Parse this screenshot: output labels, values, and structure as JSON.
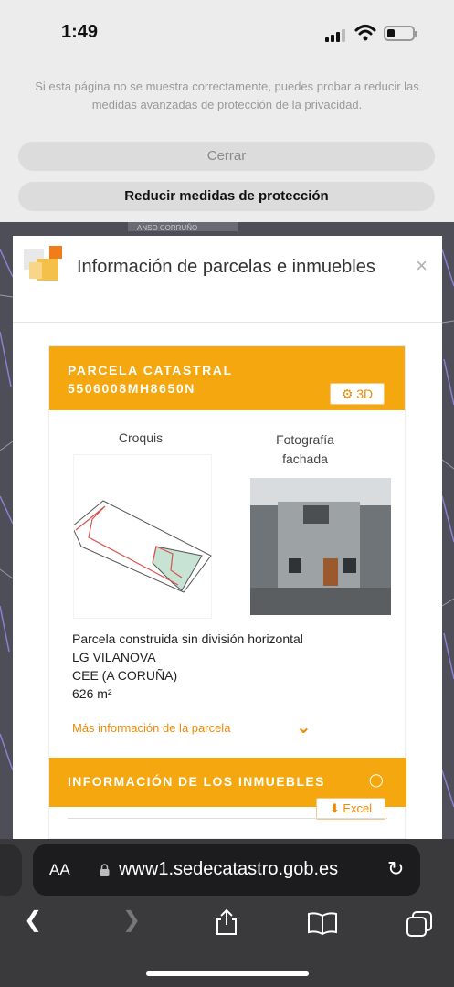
{
  "status_bar": {
    "time": "1:49"
  },
  "banner": {
    "message": "Si esta página no se muestra correctamente, puedes probar a reducir las medidas avanzadas de protección de la privacidad.",
    "close_label": "Cerrar",
    "reduce_label": "Reducir medidas de protección"
  },
  "map": {
    "road_label": "ANSO CORRUÑO"
  },
  "modal": {
    "title": "Información de parcelas e inmuebles",
    "close_glyph": "×",
    "card": {
      "header_line1": "PARCELA CATASTRAL",
      "header_line2": "5506008MH8650N",
      "btn_3d": "3D",
      "croquis_label": "Croquis",
      "foto_label_1": "Fotografía",
      "foto_label_2": "fachada",
      "info": {
        "line1": "Parcela construida sin división horizontal",
        "line2": "LG VILANOVA",
        "line3": "CEE (A CORUÑA)",
        "area": "626 m²"
      },
      "more_link": "Más información de la parcela",
      "inmuebles_title": "INFORMACIÓN DE LOS INMUEBLES",
      "excel_label": "Excel"
    }
  },
  "browser": {
    "aa_label": "AA",
    "url": "www1.sedecatastro.gob.es"
  },
  "icons": [
    "signal-icon",
    "wifi-icon",
    "battery-icon",
    "catastro-logo",
    "close-icon",
    "3d-icon",
    "chevron-down-icon",
    "comment-icon",
    "download-icon",
    "lock-icon",
    "reload-icon",
    "back-icon",
    "forward-icon",
    "share-icon",
    "bookmarks-icon",
    "tabs-icon"
  ],
  "colors": {
    "accent": "#f5a70f",
    "link": "#f08a00",
    "banner_bg": "#ececec",
    "toolbar_bg": "#3a3a3c"
  }
}
